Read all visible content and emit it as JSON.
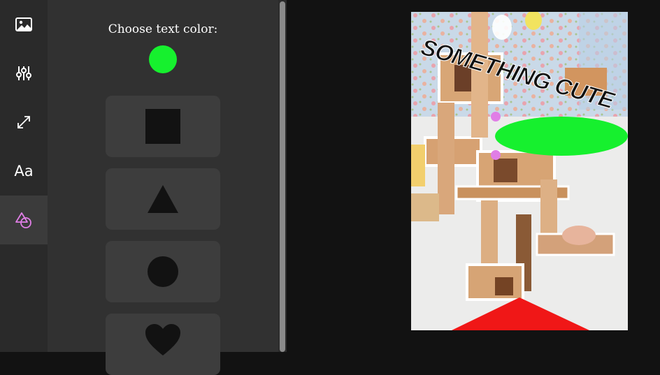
{
  "sidebar": {
    "items": [
      {
        "icon": "image-icon"
      },
      {
        "icon": "sliders-icon"
      },
      {
        "icon": "resize-icon"
      },
      {
        "icon": "text-icon",
        "label": "Aa"
      },
      {
        "icon": "shapes-icon",
        "active": true
      }
    ],
    "accent": "#e07ee6"
  },
  "panel": {
    "title": "Choose text color:",
    "selected_color": "#16f02e",
    "shapes": [
      "square",
      "triangle",
      "circle",
      "heart"
    ]
  },
  "canvas": {
    "caption": "SOMETHING CUTE",
    "ellipse_color": "#16f02e",
    "triangle_color": "#f01717",
    "handle_color": "#e07ee6"
  }
}
